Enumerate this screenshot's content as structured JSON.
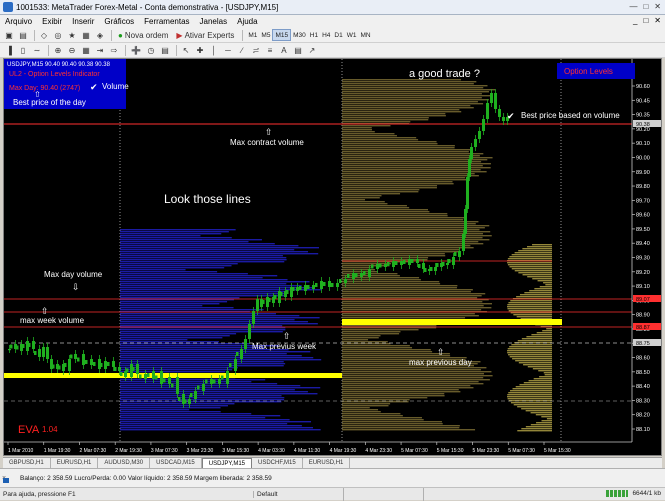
{
  "window": {
    "title": "1001533: MetaTrader Forex-Metal - Conta demonstrativa - [USDJPY,M15]"
  },
  "menu": [
    "Arquivo",
    "Exibir",
    "Inserir",
    "Gráficos",
    "Ferramentas",
    "Janelas",
    "Ajuda"
  ],
  "toolbar": {
    "new_order": "Nova ordem",
    "auto_trading": "Ativar Experts",
    "timeframes": [
      "M1",
      "M5",
      "M15",
      "M30",
      "H1",
      "H4",
      "D1",
      "W1",
      "MN"
    ],
    "active_timeframe": "M15"
  },
  "chart": {
    "info": "USDJPY,M15  90.40 90.40 90.38 90.38",
    "indicator_lines": [
      "UL2 - Option Levels Indicator",
      "Max Day: 90.40 (2747)"
    ],
    "option_levels_label": "Option Levels",
    "eva_label": "EVA",
    "eva_value": "1.04",
    "annotations": {
      "volume": "Volume",
      "best_price_day": "Best price of the day",
      "good_trade": "a good trade ?",
      "best_price_volume": "Best price based on volume",
      "max_contract": "Max contract volume",
      "look_lines": "Look those lines",
      "max_day_volume": "Max day volume",
      "max_week_volume": "max week volume",
      "max_previous_week": "Max previus week",
      "max_previous_day": "max previous day"
    },
    "price_axis": [
      "90.60",
      "90.45",
      "90.35",
      "90.20",
      "90.10",
      "90.00",
      "89.90",
      "89.80",
      "89.70",
      "89.60",
      "89.50",
      "89.40",
      "89.30",
      "89.20",
      "89.10",
      "89.00",
      "88.90",
      "88.80",
      "88.70",
      "88.60",
      "88.50",
      "88.40",
      "88.30",
      "88.20",
      "88.10"
    ],
    "price_tags": [
      "90.38",
      "89.07",
      "88.87",
      "88.75"
    ],
    "time_axis": [
      "1 Mar 2010",
      "1 Mar 19:30",
      "2 Mar 07:30",
      "2 Mar 19:30",
      "3 Mar 07:30",
      "3 Mar 23:30",
      "3 Mar 15:30",
      "4 Mar 03:30",
      "4 Mar 11:30",
      "4 Mar 19:30",
      "4 Mar 23:30",
      "5 Mar 07:30",
      "5 Mar 15:30",
      "5 Mar 23:30",
      "5 Mar 07:30",
      "5 Mar 15:30"
    ],
    "colors": {
      "background": "#000000",
      "candles": "#1fb01f",
      "volume_profile_day": "#8a7a3a",
      "volume_profile_week": "#2020c0",
      "max_volume_line": "#ffff00",
      "level_line": "#ff3030"
    }
  },
  "tabs": [
    "GBPUSD,H1",
    "EURUSD,H1",
    "AUDUSD,M30",
    "USDCAD,M15",
    "USDJPY,M15",
    "USDCHF,M15",
    "EURUSD,H1"
  ],
  "active_tab": "USDJPY,M15",
  "terminal": {
    "balance_line": "Balanço: 2 358.59  Lucro/Perda: 0.00  Valor líquido: 2 358.59  Margem liberada: 2 358.59"
  },
  "status": {
    "hint": "Para ajuda, pressione F1",
    "profile": "Default",
    "traffic": "6644/1 kb"
  }
}
